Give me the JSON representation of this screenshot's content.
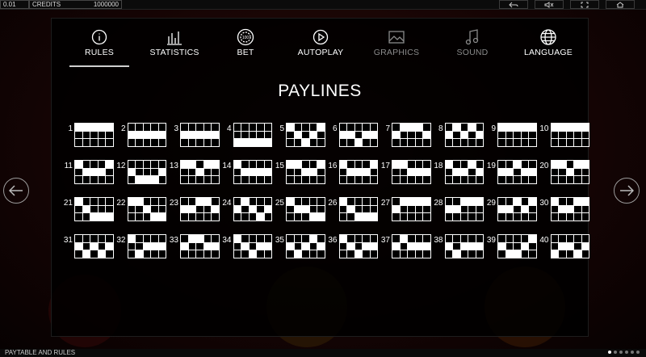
{
  "topbar": {
    "balance": "0.01",
    "credits_label": "CREDITS",
    "credits_value": "1000000"
  },
  "tabs": [
    {
      "label": "RULES",
      "icon": "info-icon",
      "active": true
    },
    {
      "label": "STATISTICS",
      "icon": "bar-chart-icon"
    },
    {
      "label": "BET",
      "icon": "chip-icon"
    },
    {
      "label": "AUTOPLAY",
      "icon": "play-icon"
    },
    {
      "label": "GRAPHICS",
      "icon": "image-icon"
    },
    {
      "label": "SOUND",
      "icon": "music-note-icon"
    },
    {
      "label": "LANGUAGE",
      "icon": "globe-icon"
    }
  ],
  "title": "PAYLINES",
  "paylines": [
    {
      "n": "1",
      "rows": [
        0,
        0,
        0,
        0,
        0
      ]
    },
    {
      "n": "2",
      "rows": [
        1,
        1,
        1,
        1,
        1
      ]
    },
    {
      "n": "3",
      "rows": [
        1,
        1,
        1,
        1,
        1
      ]
    },
    {
      "n": "4",
      "rows": [
        2,
        2,
        2,
        2,
        2
      ]
    },
    {
      "n": "5",
      "rows": [
        0,
        1,
        2,
        1,
        0
      ]
    },
    {
      "n": "6",
      "rows": [
        1,
        1,
        2,
        1,
        1
      ]
    },
    {
      "n": "7",
      "rows": [
        1,
        0,
        0,
        0,
        1
      ]
    },
    {
      "n": "8",
      "rows": [
        1,
        0,
        1,
        0,
        1
      ]
    },
    {
      "n": "9",
      "rows": [
        0,
        0,
        0,
        0,
        0
      ]
    },
    {
      "n": "10",
      "rows": [
        0,
        0,
        0,
        0,
        0
      ]
    },
    {
      "n": "11",
      "rows": [
        0,
        1,
        1,
        1,
        0
      ]
    },
    {
      "n": "12",
      "rows": [
        1,
        2,
        2,
        2,
        1
      ]
    },
    {
      "n": "13",
      "rows": [
        0,
        0,
        1,
        0,
        0
      ]
    },
    {
      "n": "14",
      "rows": [
        0,
        1,
        1,
        1,
        1
      ]
    },
    {
      "n": "15",
      "rows": [
        0,
        0,
        1,
        1,
        0
      ]
    },
    {
      "n": "16",
      "rows": [
        0,
        1,
        1,
        1,
        0
      ]
    },
    {
      "n": "17",
      "rows": [
        0,
        0,
        1,
        1,
        1
      ]
    },
    {
      "n": "18",
      "rows": [
        0,
        1,
        1,
        0,
        1
      ]
    },
    {
      "n": "19",
      "rows": [
        1,
        1,
        0,
        1,
        1
      ]
    },
    {
      "n": "20",
      "rows": [
        0,
        0,
        1,
        0,
        0
      ]
    },
    {
      "n": "21",
      "rows": [
        0,
        1,
        2,
        2,
        2
      ]
    },
    {
      "n": "22",
      "rows": [
        0,
        0,
        1,
        2,
        2
      ]
    },
    {
      "n": "23",
      "rows": [
        1,
        1,
        0,
        0,
        1
      ]
    },
    {
      "n": "24",
      "rows": [
        1,
        0,
        1,
        2,
        1
      ]
    },
    {
      "n": "25",
      "rows": [
        0,
        1,
        1,
        2,
        2
      ]
    },
    {
      "n": "26",
      "rows": [
        0,
        1,
        2,
        2,
        2
      ]
    },
    {
      "n": "27",
      "rows": [
        1,
        0,
        0,
        0,
        0
      ]
    },
    {
      "n": "28",
      "rows": [
        1,
        1,
        0,
        0,
        0
      ]
    },
    {
      "n": "29",
      "rows": [
        1,
        1,
        0,
        1,
        0
      ]
    },
    {
      "n": "30",
      "rows": [
        0,
        1,
        1,
        0,
        0
      ]
    },
    {
      "n": "31",
      "rows": [
        1,
        2,
        1,
        2,
        1
      ]
    },
    {
      "n": "32",
      "rows": [
        0,
        2,
        1,
        1,
        1
      ]
    },
    {
      "n": "33",
      "rows": [
        1,
        0,
        0,
        1,
        1
      ]
    },
    {
      "n": "34",
      "rows": [
        0,
        1,
        2,
        1,
        1
      ]
    },
    {
      "n": "35",
      "rows": [
        1,
        2,
        1,
        0,
        1
      ]
    },
    {
      "n": "36",
      "rows": [
        0,
        1,
        2,
        1,
        1
      ]
    },
    {
      "n": "37",
      "rows": [
        1,
        0,
        1,
        1,
        1
      ]
    },
    {
      "n": "38",
      "rows": [
        1,
        2,
        1,
        1,
        1
      ]
    },
    {
      "n": "39",
      "rows": [
        1,
        2,
        2,
        1,
        0
      ]
    },
    {
      "n": "40",
      "rows": [
        2,
        1,
        1,
        2,
        1
      ]
    }
  ],
  "bottombar": {
    "label": "PAYTABLE AND RULES"
  },
  "nav": {
    "prev_icon": "arrow-left-icon",
    "next_icon": "arrow-right-icon"
  },
  "colors": {
    "accent": "#ffffff",
    "dim": "#8a8a8a",
    "bg": "#140404"
  }
}
